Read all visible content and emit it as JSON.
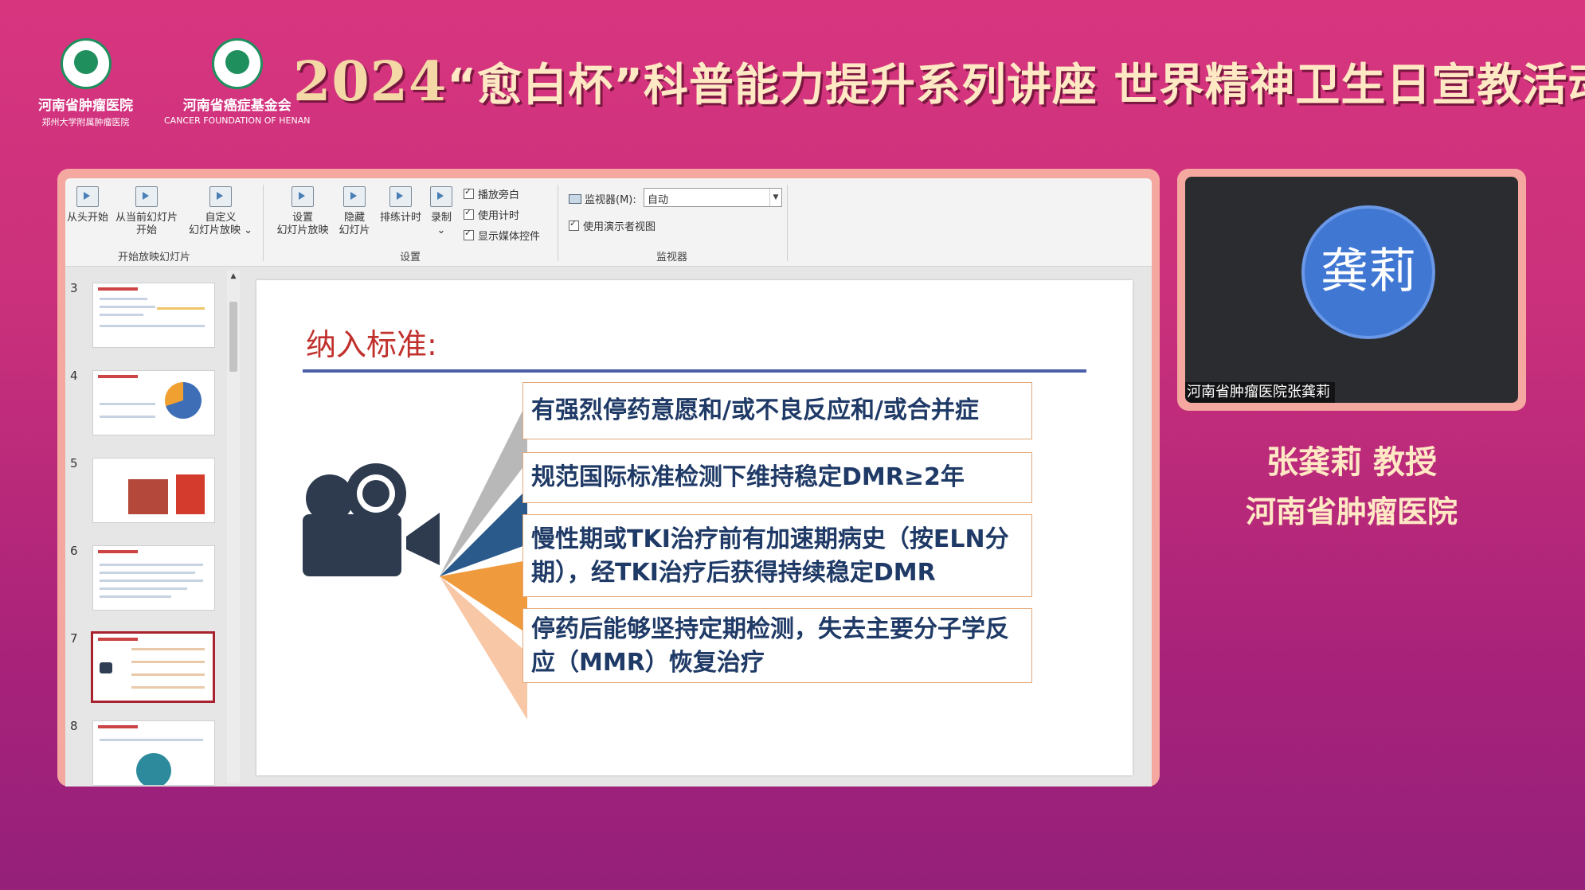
{
  "banner": {
    "logo1": {
      "line1": "河南省肿瘤医院",
      "line2": "郑州大学附属肿瘤医院"
    },
    "logo2": {
      "line1": "河南省癌症基金会",
      "line2": "CANCER FOUNDATION OF HENAN"
    },
    "year": "2024",
    "title": "“愈白杯”科普能力提升系列讲座 世界精神卫生日宣教活动"
  },
  "ribbon": {
    "btn_from_start": "从头开始",
    "btn_from_current_1": "从当前幻灯片",
    "btn_from_current_2": "开始",
    "btn_custom_1": "自定义",
    "btn_custom_2": "幻灯片放映 ⌄",
    "group_start": "开始放映幻灯片",
    "btn_setup_1": "设置",
    "btn_setup_2": "幻灯片放映",
    "btn_hide_1": "隐藏",
    "btn_hide_2": "幻灯片",
    "btn_rehearse": "排练计时",
    "btn_record": "录制",
    "btn_record_arrow": "⌄",
    "chk_narration": "播放旁白",
    "chk_timing": "使用计时",
    "chk_media": "显示媒体控件",
    "group_setup": "设置",
    "monitor_label": "监视器(M):",
    "monitor_value": "自动",
    "chk_presenter": "使用演示者视图",
    "group_monitor": "监视器"
  },
  "thumbnails": {
    "numbers": [
      "3",
      "4",
      "5",
      "6",
      "7",
      "8"
    ],
    "selected": "7"
  },
  "slide": {
    "title": "纳入标准:",
    "criteria": [
      "有强烈停药意愿和/或不良反应和/或合并症",
      "规范国际标准检测下维持稳定DMR≥2年",
      "慢性期或TKI治疗前有加速期病史（按ELN分期），经TKI治疗后获得持续稳定DMR",
      "停药后能够坚持定期检测，失去主要分子学反应（MMR）恢复治疗"
    ]
  },
  "speaker": {
    "avatar_text": "龚莉",
    "camera_label": "河南省肿瘤医院张龚莉",
    "name": "张龚莉 教授",
    "org": "河南省肿瘤医院"
  }
}
